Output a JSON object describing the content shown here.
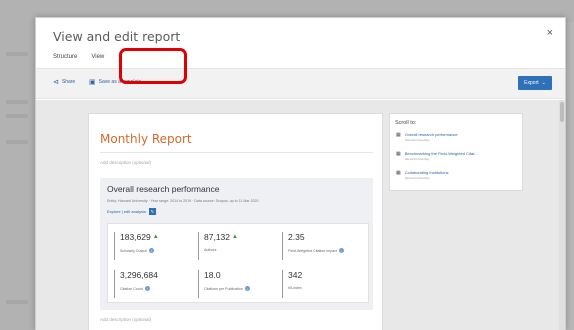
{
  "modal": {
    "title": "View and edit report",
    "close_glyph": "×",
    "tabs": [
      {
        "label": "Structure",
        "active": false
      },
      {
        "label": "View",
        "active": true
      }
    ]
  },
  "toolbar": {
    "share_label": "Share",
    "share_icon": "share-icon",
    "template_label": "Save as a template",
    "template_icon": "template-icon",
    "export_label": "Export",
    "export_icon": "chevron-down-icon"
  },
  "report": {
    "title": "Monthly Report",
    "add_description": "Add description (optional)",
    "add_description_2": "Add description (optional)",
    "section": {
      "title": "Overall research performance",
      "meta": "Entity: Harvard University  ·  Year range: 2014 to 2019  ·  Data source: Scopus, up to 11 Mar 2020",
      "links": "Explore | edit analysis",
      "metrics": [
        {
          "value": "183,629",
          "trend": "up",
          "label": "Scholarly Output",
          "info": true
        },
        {
          "value": "87,132",
          "trend": "up",
          "label": "Authors",
          "info": false
        },
        {
          "value": "2.35",
          "trend": "",
          "label": "Field-Weighted Citation Impact",
          "info": true
        },
        {
          "value": "3,296,684",
          "trend": "",
          "label": "Citation Count",
          "info": true
        },
        {
          "value": "18.0",
          "trend": "",
          "label": "Citations per Publication",
          "info": true
        },
        {
          "value": "342",
          "trend": "",
          "label": "h5-index",
          "info": false
        }
      ]
    }
  },
  "scroll_to": {
    "title": "Scroll to:",
    "items": [
      {
        "label": "Overall research performance",
        "sub": "Harvard University"
      },
      {
        "label": "Benchmarking the Field-Weighted Citat...",
        "sub": "Harvard University"
      },
      {
        "label": "Collaborating Institutions",
        "sub": "Harvard University"
      }
    ]
  },
  "colors": {
    "accent_orange": "#d36a2a",
    "link_blue": "#2a63a6",
    "export_blue": "#2e71b8",
    "highlight_red": "#e10000",
    "trend_green": "#2c9a39"
  }
}
